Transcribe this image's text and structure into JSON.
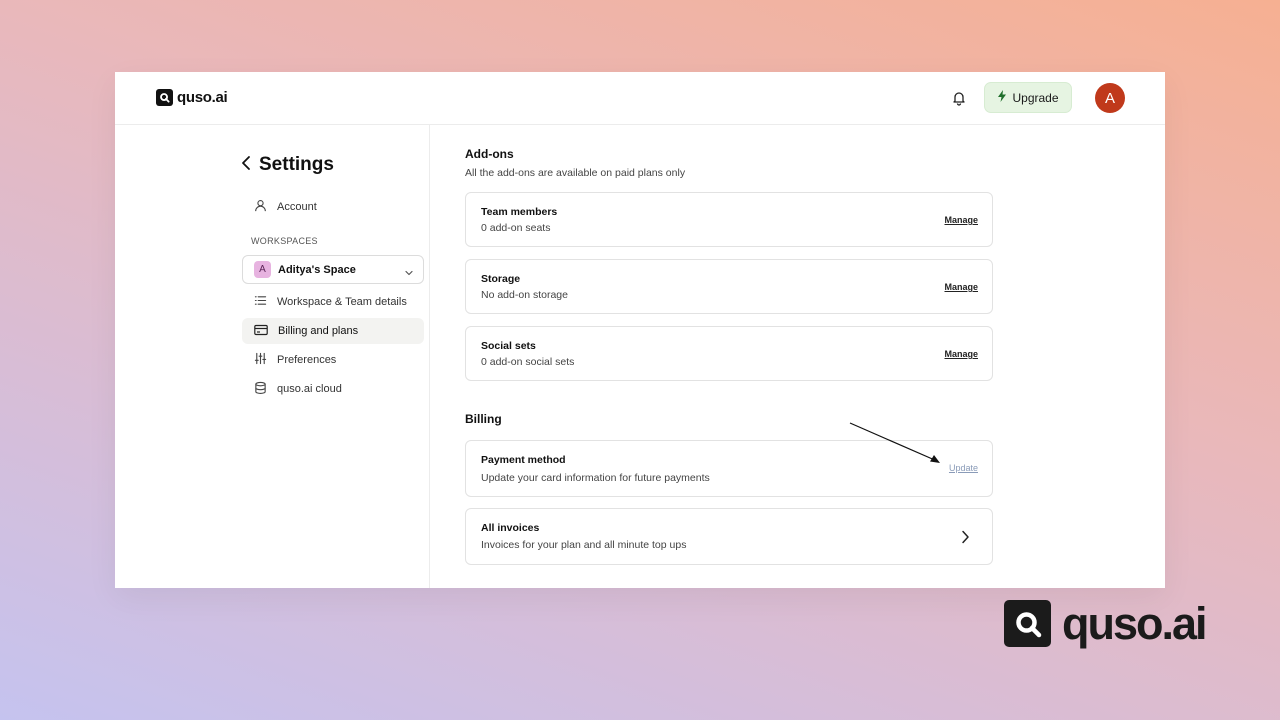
{
  "app": {
    "logo_text": "quso.ai"
  },
  "header": {
    "upgrade_label": "Upgrade",
    "avatar_initial": "A"
  },
  "sidebar": {
    "title": "Settings",
    "account_label": "Account",
    "workspaces_label": "WORKSPACES",
    "workspace": {
      "badge": "A",
      "name": "Aditya's Space"
    },
    "items": [
      {
        "label": "Workspace & Team details"
      },
      {
        "label": "Billing and plans"
      },
      {
        "label": "Preferences"
      },
      {
        "label": "quso.ai cloud"
      }
    ]
  },
  "addons": {
    "title": "Add-ons",
    "subtitle": "All the add-ons are available on paid plans only",
    "cards": [
      {
        "title": "Team members",
        "subtitle": "0 add-on seats",
        "action": "Manage"
      },
      {
        "title": "Storage",
        "subtitle": "No add-on storage",
        "action": "Manage"
      },
      {
        "title": "Social sets",
        "subtitle": "0 add-on social sets",
        "action": "Manage"
      }
    ]
  },
  "billing": {
    "title": "Billing",
    "payment": {
      "title": "Payment method",
      "subtitle": "Update your card information for future payments",
      "action": "Update"
    },
    "invoices": {
      "title": "All invoices",
      "subtitle": "Invoices for your plan and all minute top ups"
    }
  },
  "brand": {
    "text": "quso.ai"
  }
}
